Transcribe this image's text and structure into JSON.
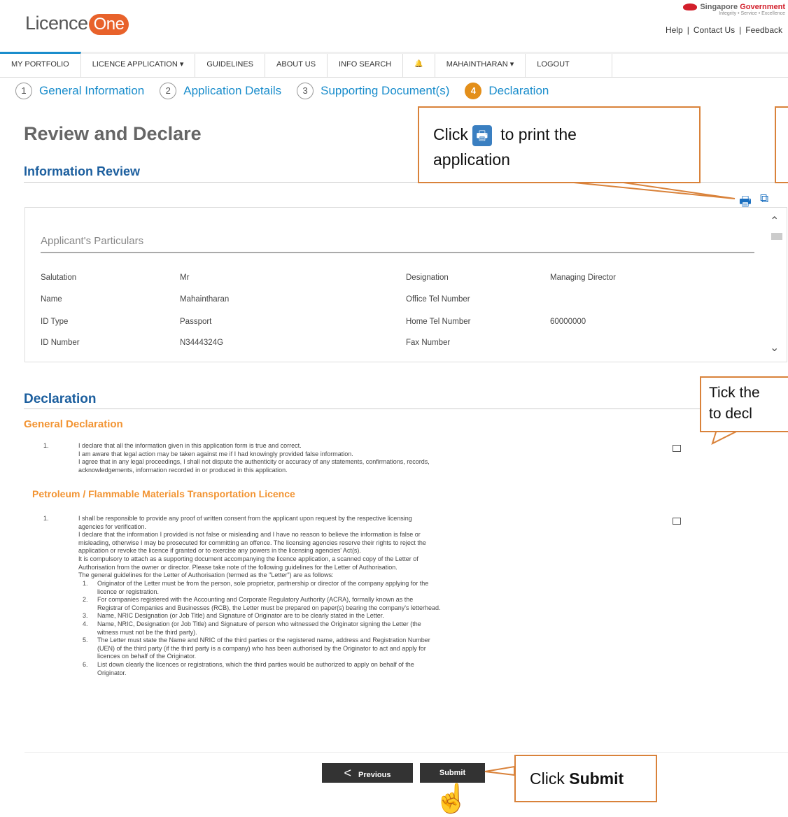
{
  "header": {
    "logo_text": "Licence",
    "logo_badge": "One",
    "gov_title_1": "Singapore",
    "gov_title_2": "Government",
    "gov_tagline": "Integrity • Service • Excellence",
    "links": [
      "Help",
      "Contact Us",
      "Feedback"
    ]
  },
  "nav": {
    "items": [
      "MY PORTFOLIO",
      "LICENCE APPLICATION ▾",
      "GUIDELINES",
      "ABOUT US",
      "INFO SEARCH",
      "🔔",
      "MAHAINTHARAN ▾",
      "LOGOUT"
    ]
  },
  "steps": [
    {
      "num": "1",
      "label": "General Information"
    },
    {
      "num": "2",
      "label": "Application Details"
    },
    {
      "num": "3",
      "label": "Supporting Document(s)"
    },
    {
      "num": "4",
      "label": "Declaration"
    }
  ],
  "page_title": "Review and Declare",
  "info_review_title": "Information Review",
  "applicant": {
    "heading": "Applicant's Particulars",
    "rows": [
      {
        "l1": "Salutation",
        "v1": "Mr",
        "l2": "Designation",
        "v2": "Managing Director"
      },
      {
        "l1": "Name",
        "v1": "Mahaintharan",
        "l2": "Office Tel Number",
        "v2": ""
      },
      {
        "l1": "ID Type",
        "v1": "Passport",
        "l2": "Home Tel Number",
        "v2": "60000000"
      },
      {
        "l1": "ID Number",
        "v1": "N3444324G",
        "l2": "Fax Number",
        "v2": ""
      }
    ]
  },
  "declaration": {
    "title": "Declaration",
    "general_title": "General Declaration",
    "general_num": "1.",
    "general_lines": [
      "I declare that all the information given in this application form is true and correct.",
      "I am aware that legal action may be taken against me if I had knowingly provided false information.",
      "I agree that in any legal proceedings, I shall not dispute the authenticity or accuracy of any statements, confirmations, records,",
      "acknowledgements, information recorded in or produced in this application."
    ],
    "petro_title": "Petroleum / Flammable Materials Transportation Licence",
    "petro_num": "1.",
    "petro_lines": [
      "I shall be responsible to provide any proof of written consent from the applicant upon request by the respective licensing",
      "agencies for verification.",
      "I declare that the information I provided is not false or misleading and I have no reason to believe the information is false or",
      "misleading, otherwise I may be prosecuted for committing an offence. The licensing agencies reserve their rights to reject the",
      "application or revoke the licence if granted or to exercise any powers in the licensing agencies' Act(s).",
      "It is compulsory to attach as a supporting document accompanying the licence application, a scanned copy of the Letter of",
      "Authorisation from the owner or director. Please take note of the following guidelines for the Letter of Authorisation.",
      "The general guidelines for the Letter of Authorisation (termed as the \"Letter\") are as follows:"
    ],
    "guidelines": [
      {
        "n": "1.",
        "lines": [
          "Originator of the Letter must be from the person, sole proprietor, partnership or director of the company applying for the",
          "licence or registration."
        ]
      },
      {
        "n": "2.",
        "lines": [
          "For companies registered with the Accounting and Corporate Regulatory Authority (ACRA), formally known as the",
          "Registrar of Companies and Businesses (RCB), the Letter must be prepared on paper(s) bearing the company's letterhead."
        ]
      },
      {
        "n": "3.",
        "lines": [
          "Name, NRIC Designation (or Job Title) and Signature of Originator are to be clearly stated in the Letter."
        ]
      },
      {
        "n": "4.",
        "lines": [
          "Name, NRIC, Designation (or Job Title) and Signature of person who witnessed the Originator signing the Letter (the",
          "witness must not be the third party)."
        ]
      },
      {
        "n": "5.",
        "lines": [
          "The Letter must state the Name and NRIC of the third parties or the registered name, address and Registration Number",
          "(UEN) of the third party (if the third party is a company) who has been authorised by the Originator to act and apply for",
          "licences on behalf of the Originator."
        ]
      },
      {
        "n": "6.",
        "lines": [
          "List down clearly the licences or registrations, which the third parties would be authorized to apply on behalf of the",
          "Originator."
        ]
      }
    ]
  },
  "buttons": {
    "previous": "Previous",
    "previous_icon": "<",
    "submit": "Submit"
  },
  "callouts": {
    "print_1": "Click",
    "print_2": "to print the",
    "print_3": "application",
    "tick_1": "Tick the",
    "tick_2": "to decl",
    "submit_1": "Click ",
    "submit_2": "Submit"
  },
  "colors": {
    "accent_blue": "#1a8dcc",
    "orange": "#f29433",
    "step_current": "#e38f1a",
    "callout_border": "#d9823a"
  }
}
